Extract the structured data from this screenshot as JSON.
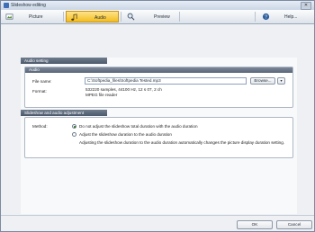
{
  "window": {
    "title": "Slideshow editing",
    "close_glyph": "✕"
  },
  "toolbar": {
    "items": [
      {
        "label": "Picture",
        "icon": "picture-icon"
      },
      {
        "label": "Audio",
        "icon": "music-note-icon",
        "active": true
      },
      {
        "label": "Preview",
        "icon": "preview-icon"
      },
      {
        "label": "Help...",
        "icon": "help-icon"
      }
    ],
    "active_color": "#f6c632"
  },
  "audio_setting": {
    "group_title": "Audio setting",
    "section_title": "Audio",
    "file_name_label": "File name:",
    "file_name_value": "C:\\Softpedia_files\\Softpedia Tested.mp3",
    "browse_label": "Browse...",
    "browse_arrow": "▼",
    "format_label": "Format:",
    "format_line1": "532220 samples, 44100 Hz, 12 s 07, 2 ch",
    "format_line2": "MPEG file reader"
  },
  "slideshow": {
    "group_title": "Slideshow and audio adjustment",
    "method_label": "Method:",
    "option1": "Do not adjust the slideshow total duration with the audio duration",
    "option2": "Adjust the slideshow duration to the audio duration",
    "note": "Adjusting the slideshow duration to the audio duration automatically changes the picture display duration setting.",
    "selected": 1
  },
  "footer": {
    "ok_label": "OK",
    "cancel_label": "Cancel"
  }
}
